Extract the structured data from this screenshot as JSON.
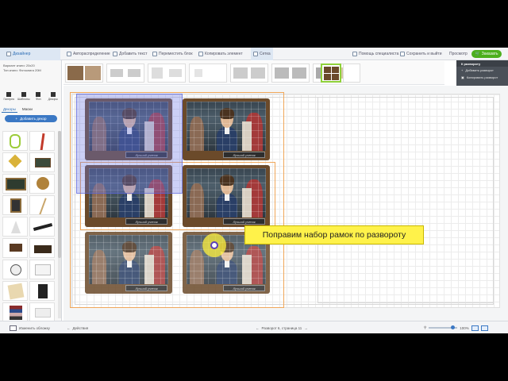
{
  "toolbar": {
    "designer_tab": "Дизайнер",
    "auto_distribute": "Автораспределение",
    "add_text": "Добавить текст",
    "move_block": "Переместить блок",
    "copy_element": "Копировать элемент",
    "grid": "Сетка",
    "help": "Помощь специалиста",
    "save_exit": "Сохранить и выйти",
    "preview": "Просмотр",
    "order": "Заказать"
  },
  "sidebar": {
    "info_line1": "Вариант книги: 20х20",
    "info_line2": "Тип книги: Фотокнига 20М",
    "tools": [
      "Галерея",
      "Шаблоны",
      "Фон",
      "Декоры"
    ],
    "tabs": [
      "Декоры",
      "Маски"
    ],
    "add_decor": "Добавить декор"
  },
  "spread_menu": {
    "title": "К развороту",
    "items": [
      "Добавить разворот",
      "Копировать разворот",
      "Удалить элемент"
    ]
  },
  "photo": {
    "caption": "Лучший ученик"
  },
  "tooltip": "Поправим набор рамок по развороту",
  "bottom": {
    "change_cover": "Изменить обложку",
    "actions": "Действия",
    "page_nav": "Разворот 6, страница 11",
    "zoom": "100%"
  },
  "colors": {
    "accent": "#3b78c4",
    "order_green": "#4caf1d",
    "tooltip_yellow": "#fff24a",
    "selection_orange": "#f0a75a"
  }
}
